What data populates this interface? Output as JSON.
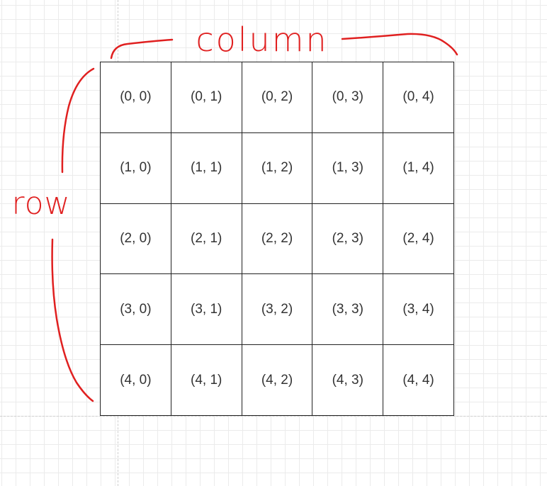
{
  "annotations": {
    "column_label": "column",
    "row_label": "row",
    "color": "#e02020"
  },
  "grid": {
    "cells": [
      [
        "(0, 0)",
        "(0, 1)",
        "(0, 2)",
        "(0, 3)",
        "(0, 4)"
      ],
      [
        "(1, 0)",
        "(1, 1)",
        "(1, 2)",
        "(1, 3)",
        "(1, 4)"
      ],
      [
        "(2, 0)",
        "(2, 1)",
        "(2, 2)",
        "(2, 3)",
        "(2, 4)"
      ],
      [
        "(3, 0)",
        "(3, 1)",
        "(3, 2)",
        "(3, 3)",
        "(3, 4)"
      ],
      [
        "(4, 0)",
        "(4, 1)",
        "(4, 2)",
        "(4, 3)",
        "(4, 4)"
      ]
    ]
  }
}
